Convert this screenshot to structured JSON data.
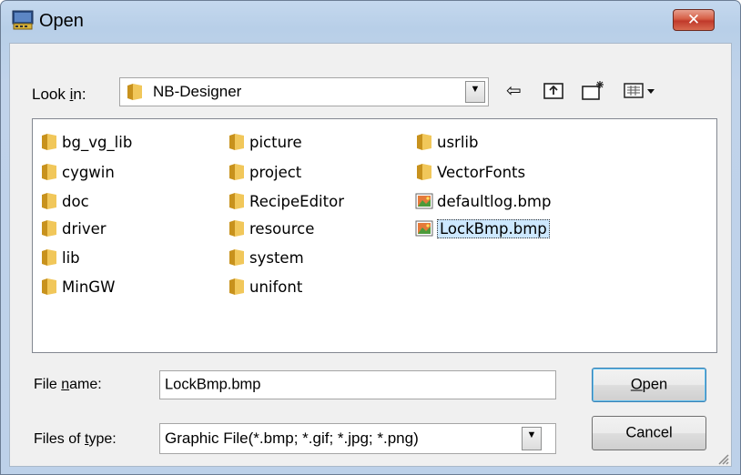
{
  "window": {
    "title": "Open",
    "close_glyph": "✕"
  },
  "look_in": {
    "label_prefix": "Look ",
    "label_accel": "i",
    "label_suffix": "n:",
    "value": "NB-Designer"
  },
  "toolbar": {
    "back_icon": "back-arrow-icon",
    "up_icon": "up-folder-icon",
    "new_folder_icon": "new-folder-icon",
    "view_icon": "view-menu-icon"
  },
  "files": {
    "col1": [
      "bg_vg_lib",
      "cygwin",
      "doc",
      "driver",
      "lib",
      "MinGW"
    ],
    "col2": [
      "picture",
      "project",
      "RecipeEditor",
      "resource",
      "system",
      "unifont"
    ],
    "col3_folders": [
      "usrlib",
      "VectorFonts"
    ],
    "col3_files": [
      "defaultlog.bmp",
      "LockBmp.bmp"
    ],
    "selected": "LockBmp.bmp"
  },
  "file_name": {
    "label_prefix": "File ",
    "label_accel": "n",
    "label_suffix": "ame:",
    "value": "LockBmp.bmp"
  },
  "file_type": {
    "label_prefix": "Files of ",
    "label_accel": "t",
    "label_suffix": "ype:",
    "value": "Graphic File(*.bmp; *.gif; *.jpg; *.png)"
  },
  "buttons": {
    "open_accel": "O",
    "open_rest": "pen",
    "cancel": "Cancel"
  },
  "colors": {
    "folder": "#e8b84a",
    "selection": "#cde8ff",
    "close": "#c75b45"
  }
}
